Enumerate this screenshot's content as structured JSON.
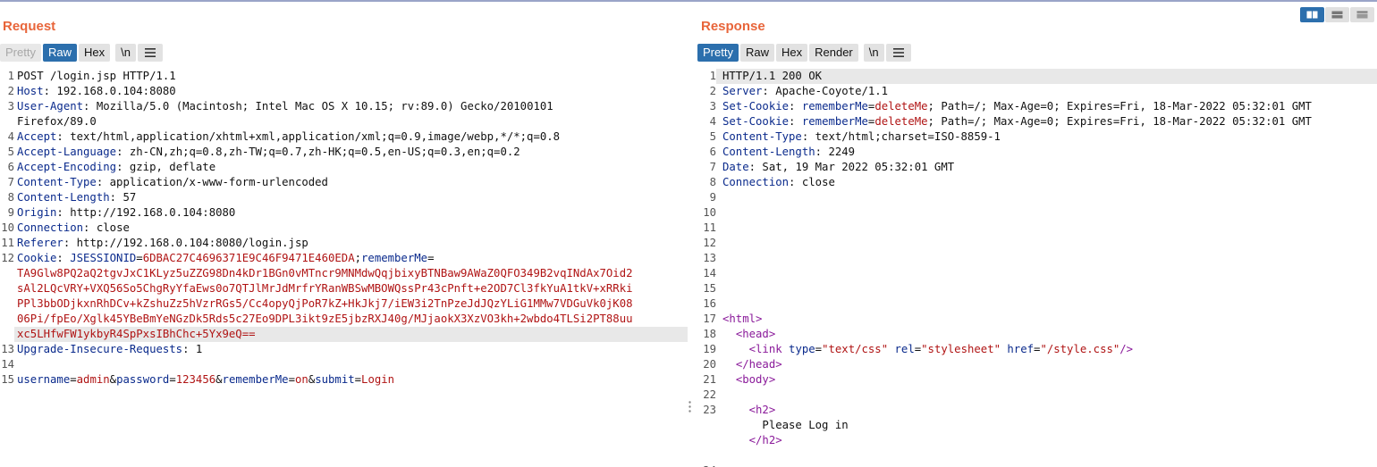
{
  "request": {
    "title": "Request",
    "tabs": [
      "Pretty",
      "Raw",
      "Hex",
      "\\n"
    ],
    "lines": [
      {
        "n": "1",
        "parts": [
          {
            "t": "POST /login.jsp HTTP/1.1"
          }
        ]
      },
      {
        "n": "2",
        "parts": [
          {
            "t": "Host",
            "c": "hn"
          },
          {
            "t": ": 192.168.0.104:8080"
          }
        ]
      },
      {
        "n": "3",
        "parts": [
          {
            "t": "User-Agent",
            "c": "hn"
          },
          {
            "t": ": Mozilla/5.0 (Macintosh; Intel Mac OS X 10.15; rv:89.0) Gecko/20100101"
          }
        ]
      },
      {
        "n": "",
        "parts": [
          {
            "t": "Firefox/89.0"
          }
        ]
      },
      {
        "n": "4",
        "parts": [
          {
            "t": "Accept",
            "c": "hn"
          },
          {
            "t": ": text/html,application/xhtml+xml,application/xml;q=0.9,image/webp,*/*;q=0.8"
          }
        ]
      },
      {
        "n": "5",
        "parts": [
          {
            "t": "Accept-Language",
            "c": "hn"
          },
          {
            "t": ": zh-CN,zh;q=0.8,zh-TW;q=0.7,zh-HK;q=0.5,en-US;q=0.3,en;q=0.2"
          }
        ]
      },
      {
        "n": "6",
        "parts": [
          {
            "t": "Accept-Encoding",
            "c": "hn"
          },
          {
            "t": ": gzip, deflate"
          }
        ]
      },
      {
        "n": "7",
        "parts": [
          {
            "t": "Content-Type",
            "c": "hn"
          },
          {
            "t": ": application/x-www-form-urlencoded"
          }
        ]
      },
      {
        "n": "8",
        "parts": [
          {
            "t": "Content-Length",
            "c": "hn"
          },
          {
            "t": ": 57"
          }
        ]
      },
      {
        "n": "9",
        "parts": [
          {
            "t": "Origin",
            "c": "hn"
          },
          {
            "t": ": http://192.168.0.104:8080"
          }
        ]
      },
      {
        "n": "10",
        "parts": [
          {
            "t": "Connection",
            "c": "hn"
          },
          {
            "t": ": close"
          }
        ]
      },
      {
        "n": "11",
        "parts": [
          {
            "t": "Referer",
            "c": "hn"
          },
          {
            "t": ": http://192.168.0.104:8080/login.jsp"
          }
        ]
      },
      {
        "n": "12",
        "parts": [
          {
            "t": "Cookie",
            "c": "hn"
          },
          {
            "t": ": "
          },
          {
            "t": "JSESSIONID",
            "c": "hn"
          },
          {
            "t": "="
          },
          {
            "t": "6DBAC27C4696371E9C46F9471E460EDA",
            "c": "red"
          },
          {
            "t": ";"
          },
          {
            "t": "rememberMe",
            "c": "hn"
          },
          {
            "t": "="
          }
        ]
      },
      {
        "n": "",
        "parts": [
          {
            "t": "TA9Glw8PQ2aQ2tgvJxC1KLyz5uZZG98Dn4kDr1BGn0vMTncr9MNMdwQqjbixyBTNBaw9AWaZ0QFO349B2vqINdAx7Oid2",
            "c": "red"
          }
        ]
      },
      {
        "n": "",
        "parts": [
          {
            "t": "sAl2LQcVRY+VXQ56So5ChgRyYfaEws0o7QTJlMrJdMrfrYRanWBSwMBOWQssPr43cPnft+e2OD7Cl3fkYuA1tkV+xRRki",
            "c": "red"
          }
        ]
      },
      {
        "n": "",
        "parts": [
          {
            "t": "PPl3bbODjkxnRhDCv+kZshuZz5hVzrRGs5/Cc4opyQjPoR7kZ+HkJkj7/iEW3i2TnPzeJdJQzYLiG1MMw7VDGuVk0jK08",
            "c": "red"
          }
        ]
      },
      {
        "n": "",
        "parts": [
          {
            "t": "06Pi/fpEo/Xglk45YBeBmYeNGzDk5Rds5c27Eo9DPL3ikt9zE5jbzRXJ40g/MJjaokX3XzVO3kh+2wbdo4TLSi2PT88uu",
            "c": "red"
          }
        ]
      },
      {
        "n": "",
        "hl": true,
        "parts": [
          {
            "t": "xc5LHfwFW1ykbyR4SpPxsIBhChc+5Yx9eQ==",
            "c": "red"
          }
        ]
      },
      {
        "n": "13",
        "parts": [
          {
            "t": "Upgrade-Insecure-Requests",
            "c": "hn"
          },
          {
            "t": ": 1"
          }
        ]
      },
      {
        "n": "14",
        "parts": [
          {
            "t": ""
          }
        ]
      },
      {
        "n": "15",
        "parts": [
          {
            "t": "username",
            "c": "hn"
          },
          {
            "t": "="
          },
          {
            "t": "admin",
            "c": "red"
          },
          {
            "t": "&"
          },
          {
            "t": "password",
            "c": "hn"
          },
          {
            "t": "="
          },
          {
            "t": "123456",
            "c": "red"
          },
          {
            "t": "&"
          },
          {
            "t": "rememberMe",
            "c": "hn"
          },
          {
            "t": "="
          },
          {
            "t": "on",
            "c": "red"
          },
          {
            "t": "&"
          },
          {
            "t": "submit",
            "c": "hn"
          },
          {
            "t": "="
          },
          {
            "t": "Login",
            "c": "red"
          }
        ]
      }
    ]
  },
  "response": {
    "title": "Response",
    "tabs": [
      "Pretty",
      "Raw",
      "Hex",
      "Render",
      "\\n"
    ],
    "lines": [
      {
        "n": "1",
        "hl": true,
        "parts": [
          {
            "t": "HTTP/1.1 200 OK"
          }
        ]
      },
      {
        "n": "2",
        "parts": [
          {
            "t": "Server",
            "c": "hn"
          },
          {
            "t": ": Apache-Coyote/1.1"
          }
        ]
      },
      {
        "n": "3",
        "parts": [
          {
            "t": "Set-Cookie",
            "c": "hn"
          },
          {
            "t": ": "
          },
          {
            "t": "rememberMe",
            "c": "hn"
          },
          {
            "t": "="
          },
          {
            "t": "deleteMe",
            "c": "red"
          },
          {
            "t": "; Path=/; Max-Age=0; Expires=Fri, 18-Mar-2022 05:32:01 GMT"
          }
        ]
      },
      {
        "n": "4",
        "parts": [
          {
            "t": "Set-Cookie",
            "c": "hn"
          },
          {
            "t": ": "
          },
          {
            "t": "rememberMe",
            "c": "hn"
          },
          {
            "t": "="
          },
          {
            "t": "deleteMe",
            "c": "red"
          },
          {
            "t": "; Path=/; Max-Age=0; Expires=Fri, 18-Mar-2022 05:32:01 GMT"
          }
        ]
      },
      {
        "n": "5",
        "parts": [
          {
            "t": "Content-Type",
            "c": "hn"
          },
          {
            "t": ": text/html;charset=ISO-8859-1"
          }
        ]
      },
      {
        "n": "6",
        "parts": [
          {
            "t": "Content-Length",
            "c": "hn"
          },
          {
            "t": ": 2249"
          }
        ]
      },
      {
        "n": "7",
        "parts": [
          {
            "t": "Date",
            "c": "hn"
          },
          {
            "t": ": Sat, 19 Mar 2022 05:32:01 GMT"
          }
        ]
      },
      {
        "n": "8",
        "parts": [
          {
            "t": "Connection",
            "c": "hn"
          },
          {
            "t": ": close"
          }
        ]
      },
      {
        "n": "9",
        "parts": [
          {
            "t": ""
          }
        ]
      },
      {
        "n": "10",
        "parts": [
          {
            "t": ""
          }
        ]
      },
      {
        "n": "11",
        "parts": [
          {
            "t": ""
          }
        ]
      },
      {
        "n": "12",
        "parts": [
          {
            "t": ""
          }
        ]
      },
      {
        "n": "13",
        "parts": [
          {
            "t": ""
          }
        ]
      },
      {
        "n": "14",
        "parts": [
          {
            "t": ""
          }
        ]
      },
      {
        "n": "15",
        "parts": [
          {
            "t": ""
          }
        ]
      },
      {
        "n": "16",
        "parts": [
          {
            "t": ""
          }
        ]
      },
      {
        "n": "17",
        "parts": [
          {
            "t": "<html>",
            "c": "tag"
          }
        ]
      },
      {
        "n": "18",
        "parts": [
          {
            "t": "  "
          },
          {
            "t": "<head>",
            "c": "tag"
          }
        ]
      },
      {
        "n": "19",
        "parts": [
          {
            "t": "    "
          },
          {
            "t": "<link ",
            "c": "tag"
          },
          {
            "t": "type",
            "c": "attr"
          },
          {
            "t": "="
          },
          {
            "t": "\"text/css\"",
            "c": "str"
          },
          {
            "t": " "
          },
          {
            "t": "rel",
            "c": "attr"
          },
          {
            "t": "="
          },
          {
            "t": "\"stylesheet\"",
            "c": "str"
          },
          {
            "t": " "
          },
          {
            "t": "href",
            "c": "attr"
          },
          {
            "t": "="
          },
          {
            "t": "\"/style.css\"",
            "c": "str"
          },
          {
            "t": "/>",
            "c": "tag"
          }
        ]
      },
      {
        "n": "20",
        "parts": [
          {
            "t": "  "
          },
          {
            "t": "</head>",
            "c": "tag"
          }
        ]
      },
      {
        "n": "21",
        "parts": [
          {
            "t": "  "
          },
          {
            "t": "<body>",
            "c": "tag"
          }
        ]
      },
      {
        "n": "22",
        "parts": [
          {
            "t": ""
          }
        ]
      },
      {
        "n": "23",
        "parts": [
          {
            "t": "    "
          },
          {
            "t": "<h2>",
            "c": "tag"
          }
        ]
      },
      {
        "n": "",
        "parts": [
          {
            "t": "      Please Log in"
          }
        ]
      },
      {
        "n": "",
        "parts": [
          {
            "t": "    "
          },
          {
            "t": "</h2>",
            "c": "tag"
          }
        ]
      },
      {
        "n": "",
        "parts": [
          {
            "t": ""
          }
        ]
      },
      {
        "n": "24",
        "parts": [
          {
            "t": ""
          }
        ]
      }
    ]
  },
  "colors": {
    "accent": "#e8653a",
    "active_tab": "#2c6fad",
    "header_name": "#0a2a8c",
    "value_red": "#b01414",
    "html_tag": "#8a1a9a"
  },
  "icons": {
    "menu": "hamburger-menu-icon",
    "layout_side_by_side": "split-columns-icon",
    "layout_stacked": "split-rows-icon",
    "layout_tabs": "single-pane-icon",
    "divider_grip": "drag-handle-icon"
  }
}
